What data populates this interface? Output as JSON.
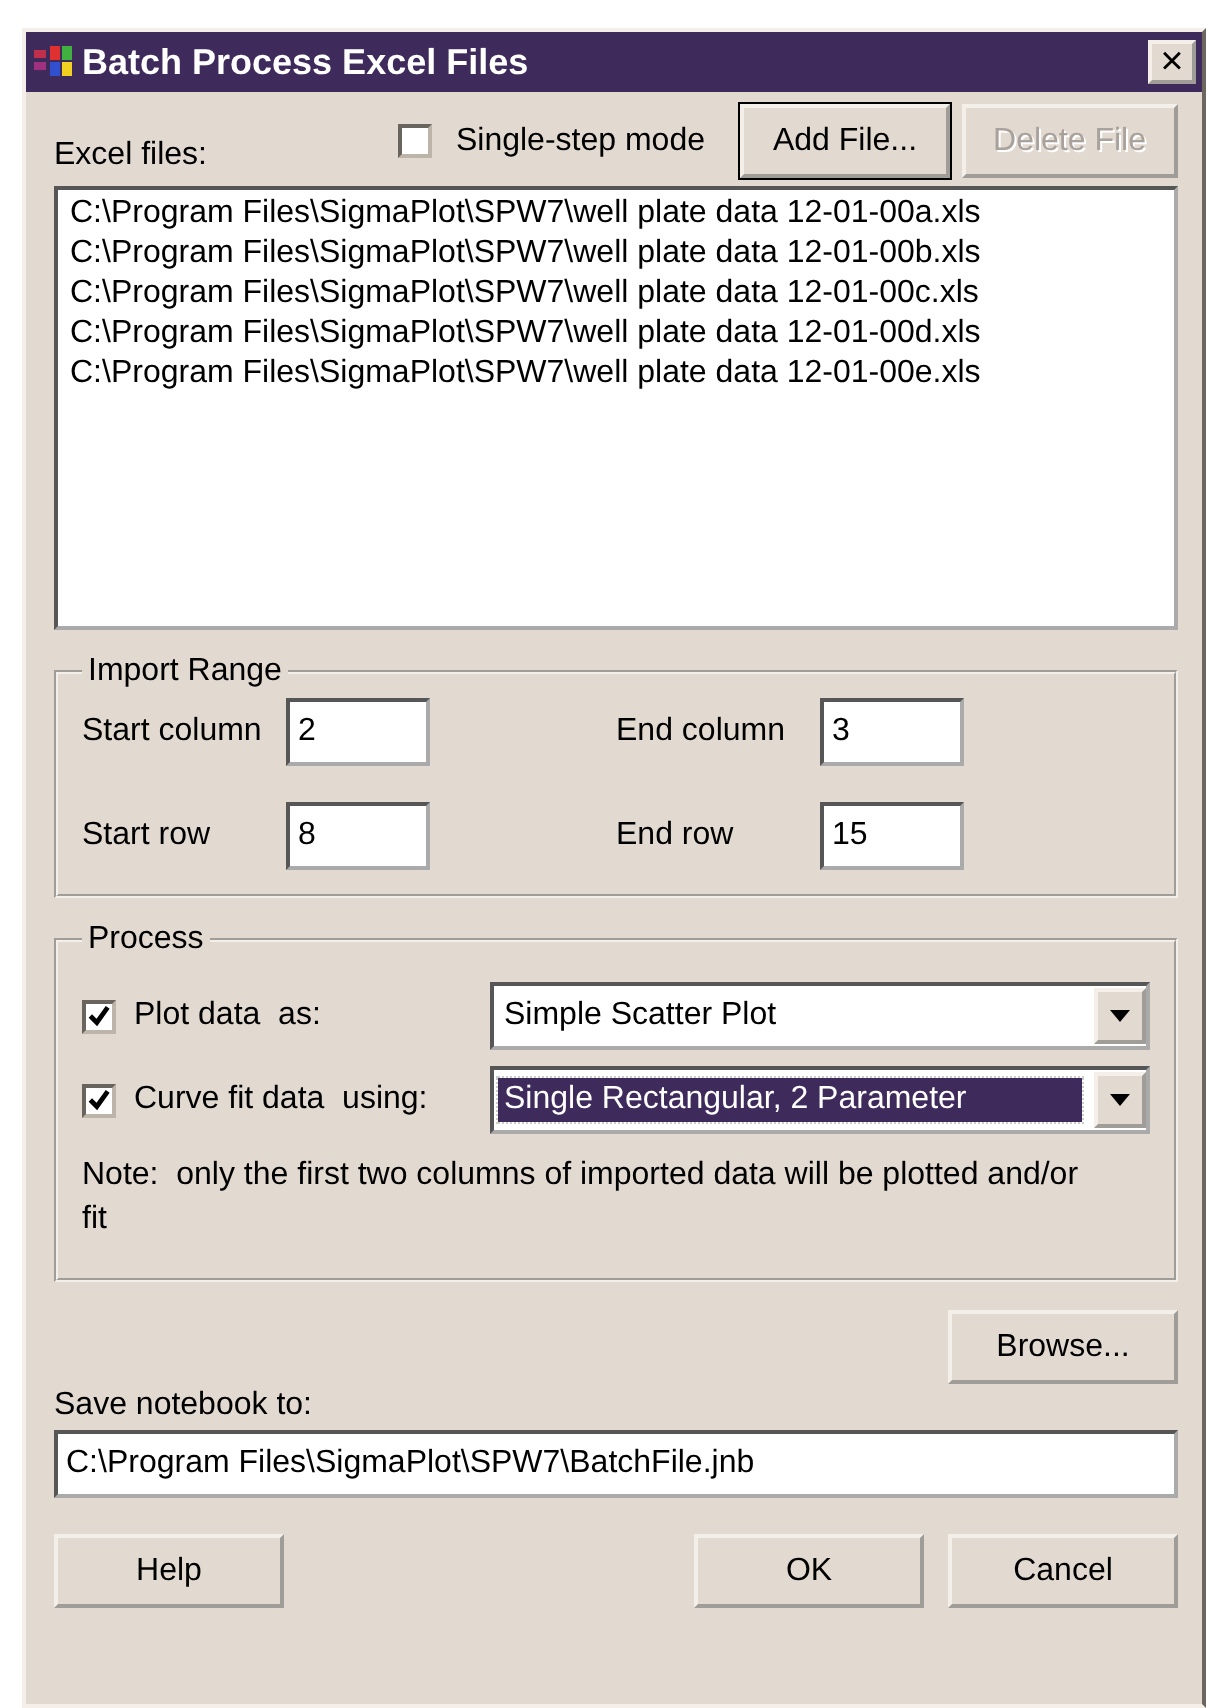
{
  "window": {
    "title": "Batch Process Excel Files",
    "close": "×"
  },
  "single_step": {
    "label": "Single-step mode",
    "checked": false
  },
  "top_buttons": [
    {
      "label": "Add File...",
      "disabled": false
    },
    {
      "label": "Delete File",
      "disabled": true
    }
  ],
  "files_label": "Excel files:",
  "files": [
    "C:\\Program Files\\SigmaPlot\\SPW7\\well plate data 12-01-00a.xls",
    "C:\\Program Files\\SigmaPlot\\SPW7\\well plate data 12-01-00b.xls",
    "C:\\Program Files\\SigmaPlot\\SPW7\\well plate data 12-01-00c.xls",
    "C:\\Program Files\\SigmaPlot\\SPW7\\well plate data 12-01-00d.xls",
    "C:\\Program Files\\SigmaPlot\\SPW7\\well plate data 12-01-00e.xls"
  ],
  "import_range": {
    "title": "Import Range",
    "fields": [
      {
        "label": "Start column",
        "value": "2"
      },
      {
        "label": "End column",
        "value": "3"
      },
      {
        "label": "Start row",
        "value": "8"
      },
      {
        "label": "End row",
        "value": "15"
      }
    ]
  },
  "process": {
    "title": "Process",
    "options": [
      {
        "label": "Plot data  as:",
        "checked": true,
        "value": "Simple Scatter Plot",
        "highlighted": false
      },
      {
        "label": "Curve fit data  using:",
        "checked": true,
        "value": "Single Rectangular, 2 Parameter",
        "highlighted": true
      }
    ],
    "note": "Note:  only the first two columns of imported data will be plotted and/or fit"
  },
  "browse_button": "Browse...",
  "save_label": "Save notebook to:",
  "save_path": "C:\\Program Files\\SigmaPlot\\SPW7\\BatchFile.jnb",
  "bottom_buttons": [
    "Help",
    "OK",
    "Cancel"
  ]
}
